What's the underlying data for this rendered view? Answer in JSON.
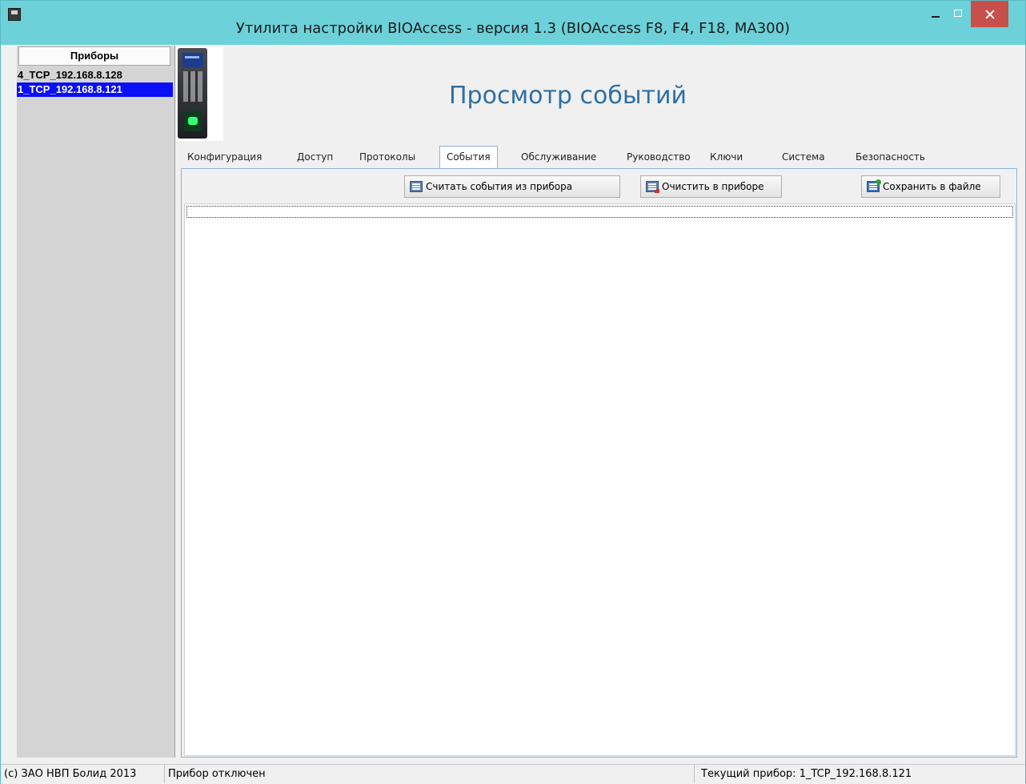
{
  "window": {
    "title": "Утилита настройки BIOAccess - версия 1.3 (BIOAccess F8, F4, F18, MA300)"
  },
  "sidebar": {
    "header": "Приборы",
    "devices": [
      {
        "label": "4_TCP_192.168.8.128",
        "selected": false
      },
      {
        "label": "1_TCP_192.168.8.121",
        "selected": true
      }
    ]
  },
  "main": {
    "page_title": "Просмотр событий"
  },
  "tabs": [
    {
      "label": "Конфигурация"
    },
    {
      "label": "Доступ"
    },
    {
      "label": "Протоколы"
    },
    {
      "label": "События",
      "active": true
    },
    {
      "label": "Обслуживание"
    },
    {
      "label": "Руководство"
    },
    {
      "label": "Ключи"
    },
    {
      "label": "Система"
    },
    {
      "label": "Безопасность"
    }
  ],
  "toolbar": {
    "read_events": "Считать события из прибора",
    "clear_device": "Очистить в приборе",
    "save_file": "Сохранить в файле"
  },
  "statusbar": {
    "copyright": "(c) ЗАО НВП Болид 2013",
    "connection": "Прибор отключен",
    "current_device": "Текущий прибор: 1_TCP_192.168.8.121"
  },
  "colors": {
    "titlebar": "#6dd1d9",
    "selection": "#0a0ff5",
    "close_button": "#c7504a",
    "page_title": "#2e6fa3"
  }
}
